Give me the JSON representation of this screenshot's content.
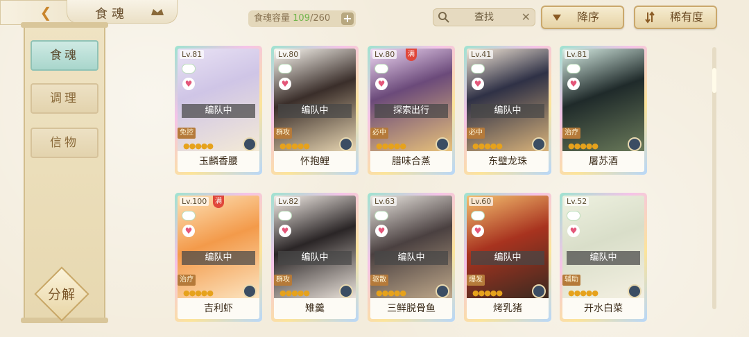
{
  "header": {
    "title": "食魂",
    "capacity_label": "食魂容量",
    "capacity_current": "109",
    "capacity_sep_total": "/260",
    "search_placeholder": "查找",
    "sort_order_label": "降序",
    "sort_field_label": "稀有度"
  },
  "sidebar": {
    "items": [
      {
        "label": "食魂"
      },
      {
        "label": "调理"
      },
      {
        "label": "信物"
      }
    ],
    "decompose_label": "分解"
  },
  "cards": [
    {
      "level": "Lv.81",
      "status": "编队中",
      "role": "免控",
      "name": "玉麟香腰",
      "full": false
    },
    {
      "level": "Lv.80",
      "status": "编队中",
      "role": "群攻",
      "name": "怀抱鲤",
      "full": false
    },
    {
      "level": "Lv.80",
      "status": "探索出行",
      "role": "必中",
      "name": "腊味合蒸",
      "full": true,
      "full_label": "满"
    },
    {
      "level": "Lv.41",
      "status": "编队中",
      "role": "必中",
      "name": "东璧龙珠",
      "full": false
    },
    {
      "level": "Lv.81",
      "status": "",
      "role": "治疗",
      "name": "屠苏酒",
      "full": false
    },
    {
      "level": "Lv.100",
      "status": "编队中",
      "role": "治疗",
      "name": "吉利虾",
      "full": true,
      "full_label": "满"
    },
    {
      "level": "Lv.82",
      "status": "编队中",
      "role": "群攻",
      "name": "雉羹",
      "full": false
    },
    {
      "level": "Lv.63",
      "status": "编队中",
      "role": "驱散",
      "name": "三鲜脱骨鱼",
      "full": false
    },
    {
      "level": "Lv.60",
      "status": "编队中",
      "role": "爆发",
      "name": "烤乳猪",
      "full": false
    },
    {
      "level": "Lv.52",
      "status": "编队中",
      "role": "辅助",
      "name": "开水白菜",
      "full": false
    }
  ],
  "colors": {
    "accent_teal": "#a9d6cc",
    "gold": "#caa86c",
    "capacity_current": "#6fb44a"
  }
}
